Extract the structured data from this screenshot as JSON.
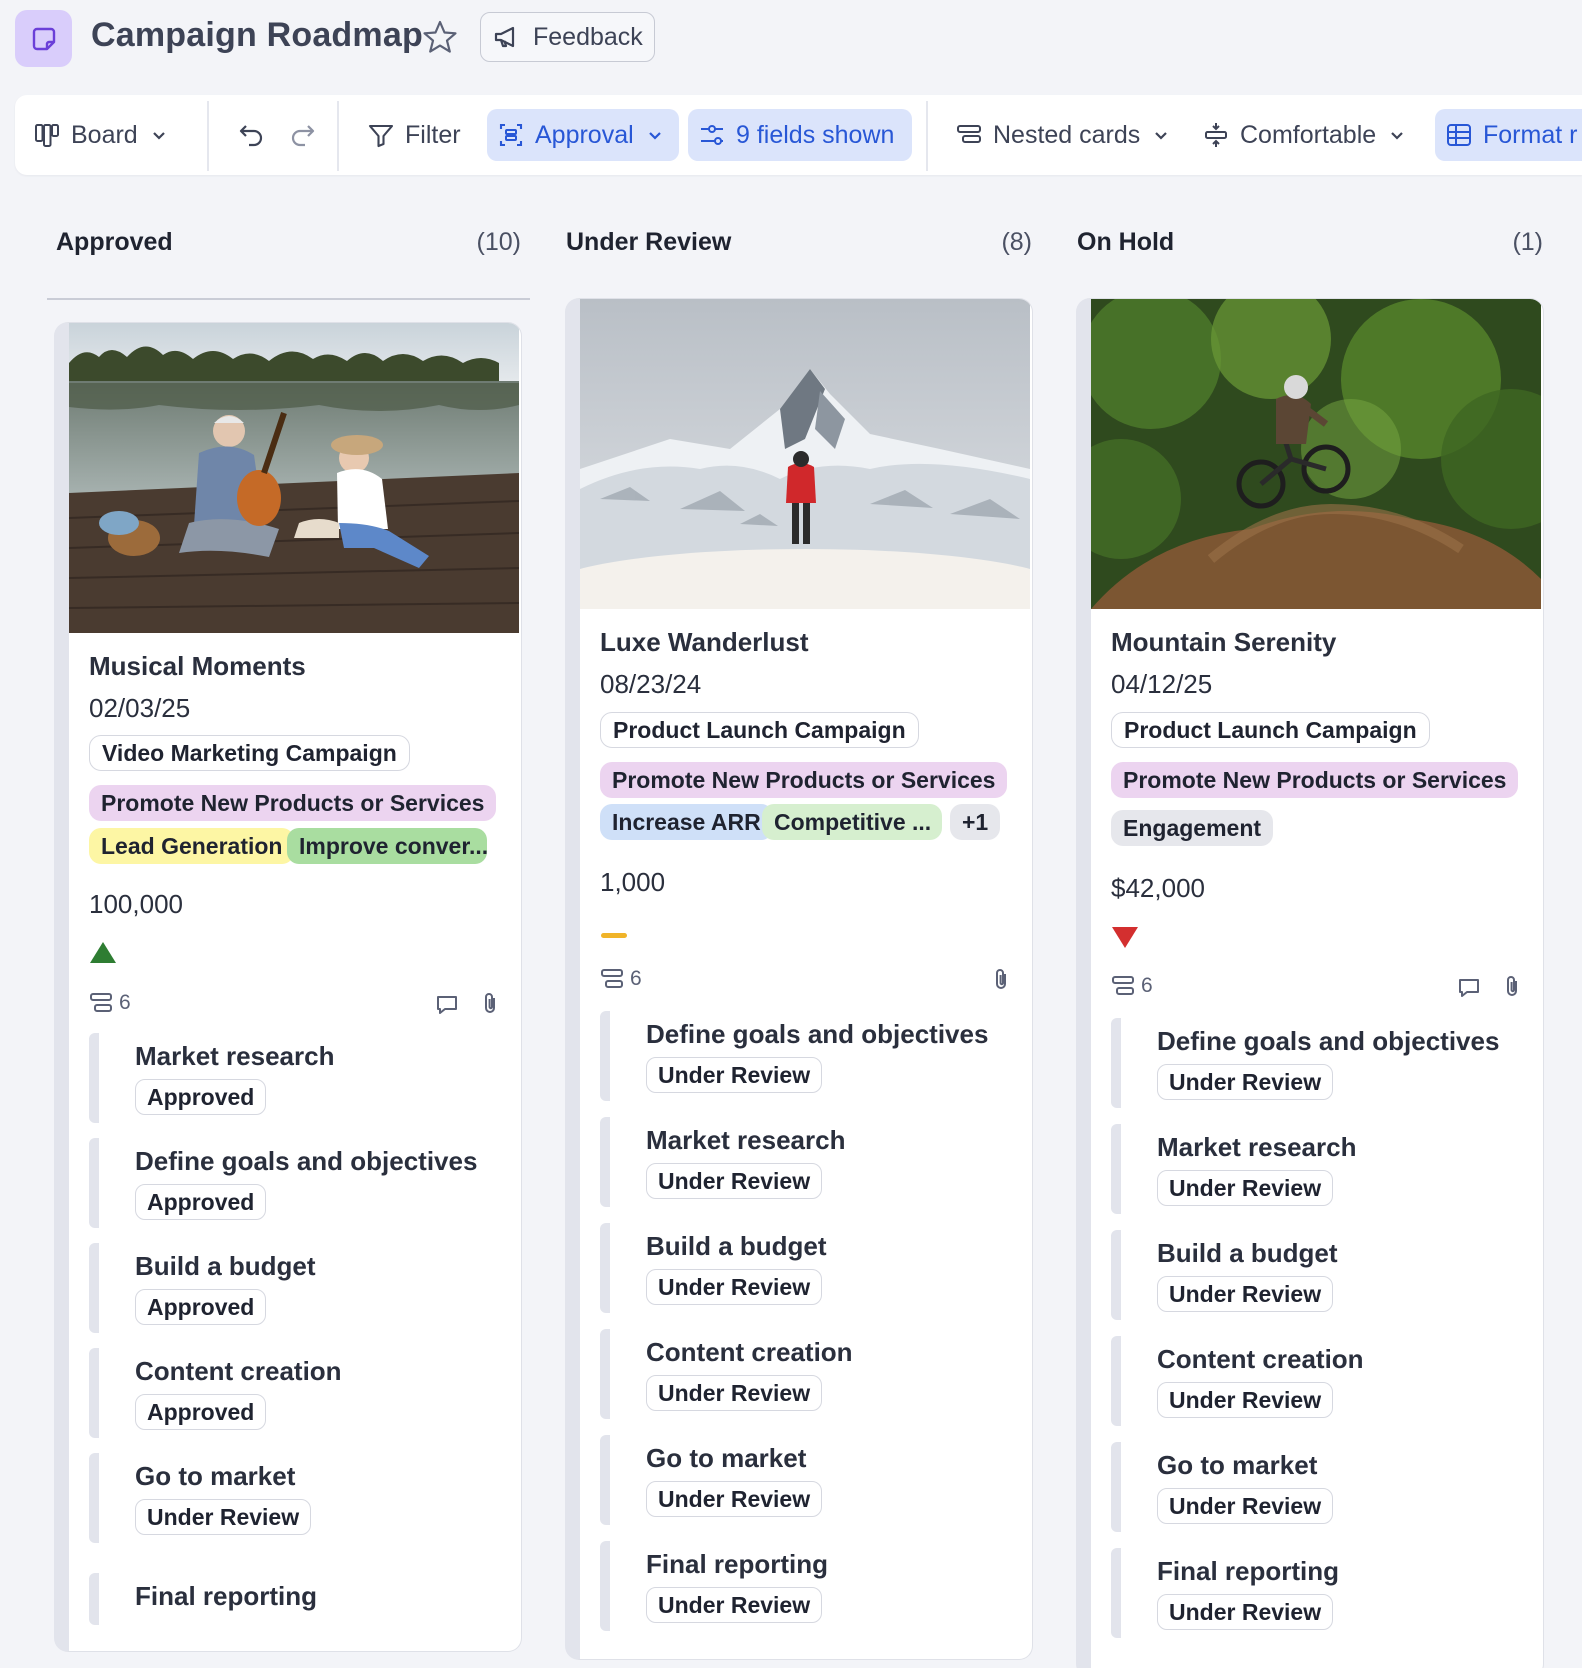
{
  "header": {
    "title": "Campaign Roadmap",
    "feedback_label": "Feedback"
  },
  "toolbar": {
    "board_label": "Board",
    "filter_label": "Filter",
    "group_label": "Approval",
    "fields_label": "9 fields shown",
    "nested_label": "Nested cards",
    "density_label": "Comfortable",
    "format_label": "Format r"
  },
  "colors": {
    "accent": "#2857d6",
    "accent_bg": "#dbe4fb",
    "trend_up": "#2e7d32",
    "trend_down": "#d32f2f",
    "trend_flat": "#f0b429"
  },
  "columns": [
    {
      "title": "Approved",
      "count": "(10)",
      "card": {
        "image": "couple-playing-guitar-on-lake-dock-photo",
        "title": "Musical Moments",
        "date": "02/03/25",
        "tags": [
          "Video Marketing Campaign",
          "Promote New Products or Services",
          "Lead Generation",
          "Improve conver..."
        ],
        "value": "100,000",
        "trend": "up-triangle-icon",
        "subtasks_count": "6",
        "subtasks": [
          {
            "title": "Market research",
            "status": "Approved"
          },
          {
            "title": "Define goals and objectives",
            "status": "Approved"
          },
          {
            "title": "Build a budget",
            "status": "Approved"
          },
          {
            "title": "Content creation",
            "status": "Approved"
          },
          {
            "title": "Go to market",
            "status": "Under Review"
          },
          {
            "title": "Final reporting",
            "status": ""
          }
        ]
      }
    },
    {
      "title": "Under Review",
      "count": "(8)",
      "card": {
        "image": "hiker-facing-snowy-mountain-photo",
        "title": "Luxe Wanderlust",
        "date": "08/23/24",
        "tags": [
          "Product Launch Campaign",
          "Promote New Products or Services",
          "Increase ARR",
          "Competitive ...",
          "+1"
        ],
        "value": "1,000",
        "trend": "flat-dash-icon",
        "subtasks_count": "6",
        "subtasks": [
          {
            "title": "Define goals and objectives",
            "status": "Under Review"
          },
          {
            "title": "Market research",
            "status": "Under Review"
          },
          {
            "title": "Build a budget",
            "status": "Under Review"
          },
          {
            "title": "Content creation",
            "status": "Under Review"
          },
          {
            "title": "Go to market",
            "status": "Under Review"
          },
          {
            "title": "Final reporting",
            "status": "Under Review"
          }
        ]
      }
    },
    {
      "title": "On Hold",
      "count": "(1)",
      "card": {
        "image": "mountain-biker-jumping-in-forest-photo",
        "title": "Mountain Serenity",
        "date": "04/12/25",
        "tags": [
          "Product Launch Campaign",
          "Promote New Products or Services",
          "Engagement"
        ],
        "value": "$42,000",
        "trend": "down-triangle-icon",
        "subtasks_count": "6",
        "subtasks": [
          {
            "title": "Define goals and objectives",
            "status": "Under Review"
          },
          {
            "title": "Market research",
            "status": "Under Review"
          },
          {
            "title": "Build a budget",
            "status": "Under Review"
          },
          {
            "title": "Content creation",
            "status": "Under Review"
          },
          {
            "title": "Go to market",
            "status": "Under Review"
          },
          {
            "title": "Final reporting",
            "status": "Under Review"
          }
        ]
      }
    }
  ]
}
